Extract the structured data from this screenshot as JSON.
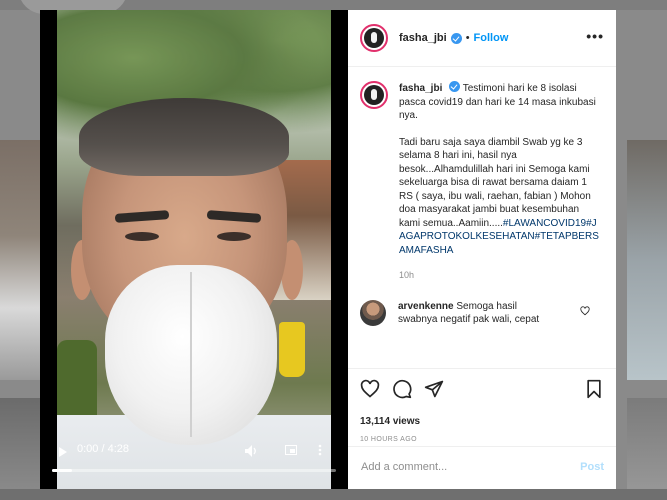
{
  "post": {
    "username": "fasha_jbi",
    "follow_label": "Follow",
    "separator": "•",
    "more_label": "•••"
  },
  "caption": {
    "username": "fasha_jbi",
    "text_1": "Testimoni hari ke 8 isolasi pasca covid19 dan hari ke 14 masa inkubasi nya.",
    "text_2": "Tadi baru saja saya diambil Swab yg ke 3 selama 8 hari ini, hasil nya besok...Alhamdulillah hari ini Semoga kami sekeluarga bisa di rawat bersama daiam 1 RS ( saya, ibu wali, raehan, fabian ) Mohon doa masyarakat jambi buat kesembuhan kami semua..Aamiin.....",
    "hashtags": "#LAWANCOVID19#JAGAPROTOKOLKESEHATAN#TETAPBERSAMAFASHA",
    "time": "10h"
  },
  "comment": {
    "username": "arvenkenne",
    "text": "Semoga hasil swabnya negatif pak wali, cepat"
  },
  "video": {
    "time": "0:00 / 4:28",
    "progress": 0.07
  },
  "stats": {
    "views": "13,114 views",
    "ago": "10 HOURS AGO"
  },
  "comment_box": {
    "placeholder": "Add a comment...",
    "post_label": "Post"
  }
}
